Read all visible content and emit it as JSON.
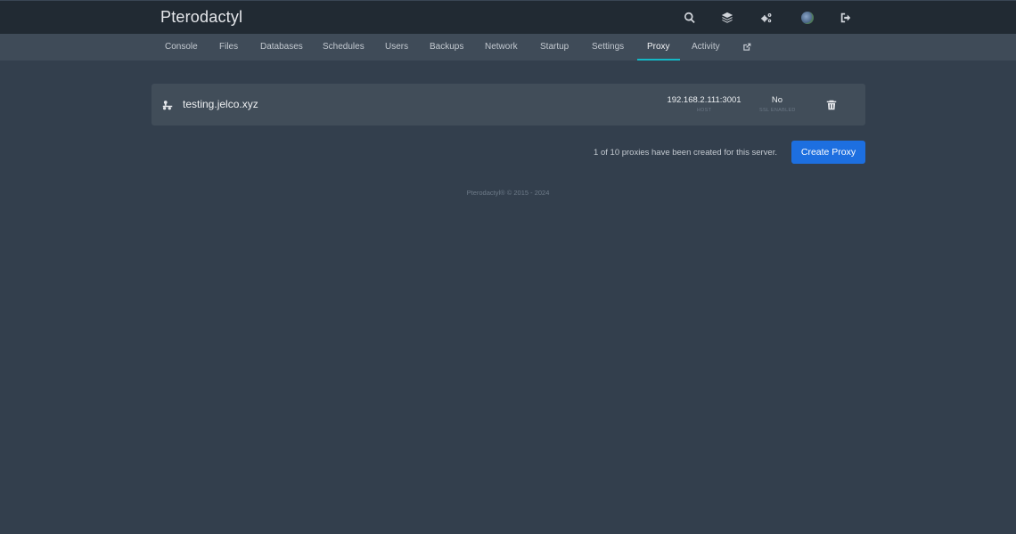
{
  "header": {
    "brand": "Pterodactyl",
    "icons": [
      "search-icon",
      "layers-icon",
      "cogs-icon",
      "avatar",
      "sign-out-icon"
    ]
  },
  "nav": {
    "tabs": [
      {
        "label": "Console"
      },
      {
        "label": "Files"
      },
      {
        "label": "Databases"
      },
      {
        "label": "Schedules"
      },
      {
        "label": "Users"
      },
      {
        "label": "Backups"
      },
      {
        "label": "Network"
      },
      {
        "label": "Startup"
      },
      {
        "label": "Settings"
      },
      {
        "label": "Proxy",
        "active": true
      },
      {
        "label": "Activity"
      }
    ],
    "external_icon": "external-link-icon"
  },
  "proxies": [
    {
      "icon": "network-wired-icon",
      "domain": "testing.jelco.xyz",
      "host": "192.168.2.111:3001",
      "host_label": "HOST",
      "ssl": "No",
      "ssl_label": "SSL ENABLED",
      "delete_icon": "trash-icon"
    }
  ],
  "summary": "1 of 10 proxies have been created for this server.",
  "create_button": "Create Proxy",
  "footer": "Pterodactyl® © 2015 - 2024",
  "colors": {
    "background": "#333f4d",
    "topbar": "#212a33",
    "subnav": "#3f4b58",
    "active_tab_underline": "#14b8c6",
    "primary_button": "#1d6fe0"
  }
}
